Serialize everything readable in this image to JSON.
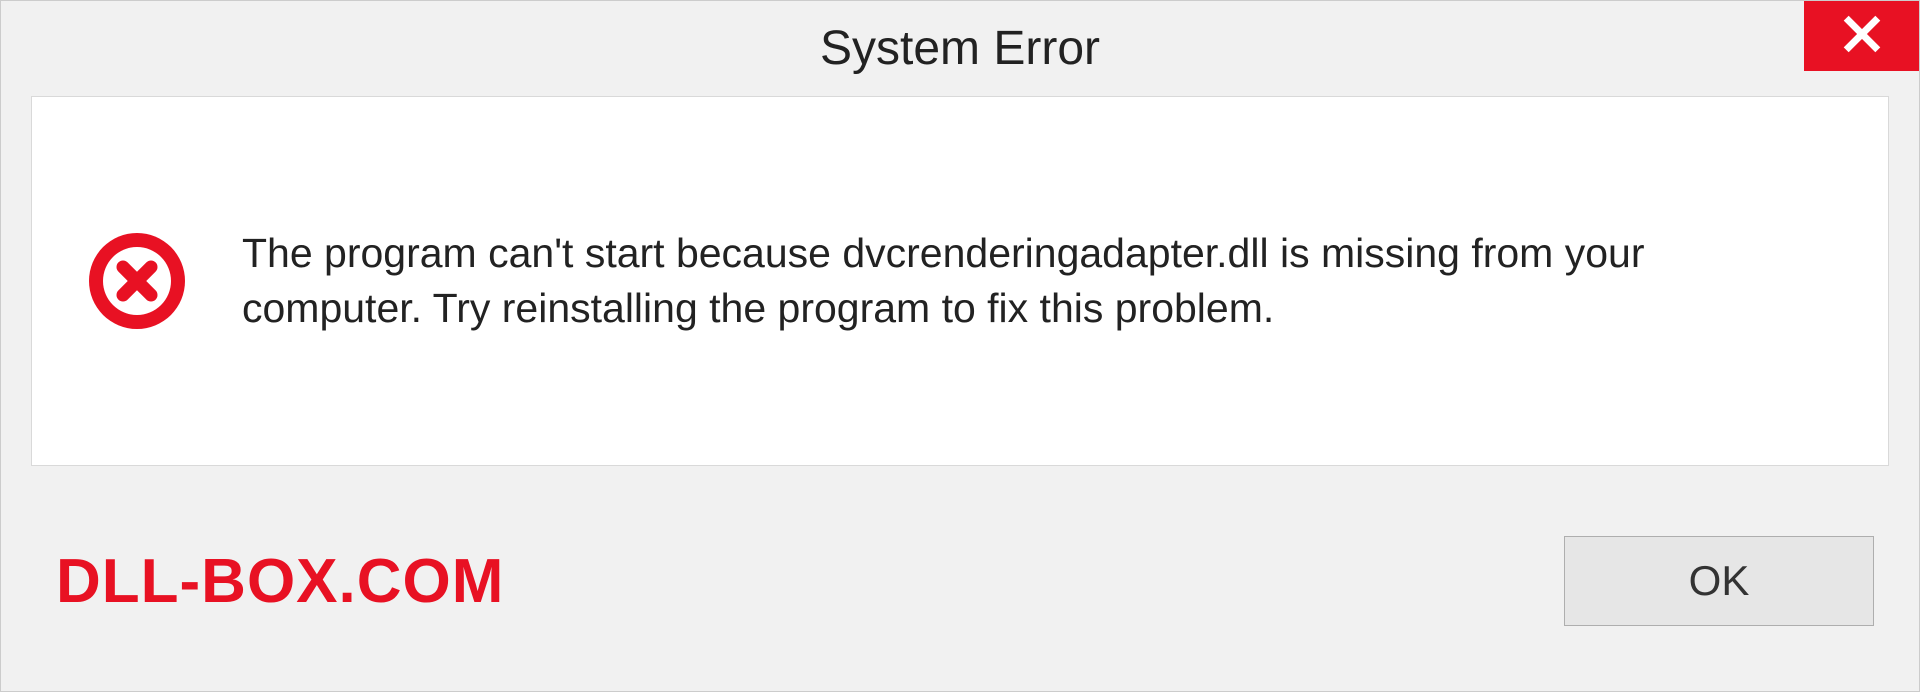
{
  "titlebar": {
    "title": "System Error"
  },
  "body": {
    "message": "The program can't start because dvcrenderingadapter.dll is missing from your computer. Try reinstalling the program to fix this problem."
  },
  "footer": {
    "brand": "DLL-BOX.COM",
    "ok_label": "OK"
  },
  "colors": {
    "accent_red": "#e81123",
    "panel_bg": "#f1f1f1"
  }
}
